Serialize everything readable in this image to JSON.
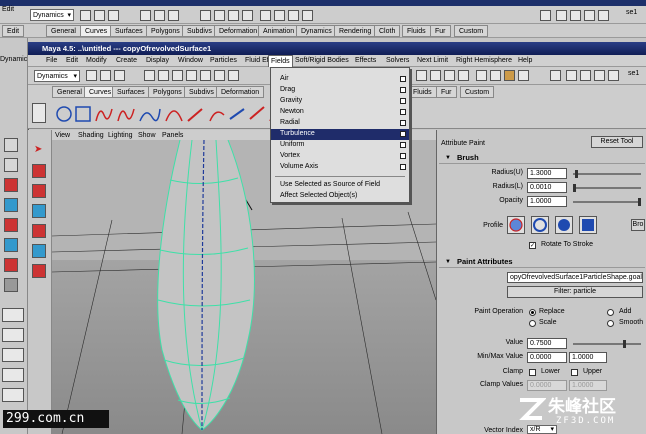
{
  "back_window": {
    "title_fragment": "Maya",
    "menu_items": [
      "Edit",
      "Dynamics",
      "Edit"
    ],
    "mode_dropdown": "Dynamics",
    "shelf_tabs": [
      "General",
      "Curves",
      "Surfaces",
      "Polygons",
      "Subdivs",
      "Deformation",
      "Animation",
      "Dynamics",
      "Rendering",
      "Cloth",
      "Fluids",
      "Fur",
      "Custom"
    ],
    "right_label": "se1"
  },
  "main_window": {
    "title": "Maya 4.5: ..\\untitled  ---  copyOfrevolvedSurface1",
    "menu": [
      "File",
      "Edit",
      "Modify",
      "Create",
      "Display",
      "Window",
      "Particles",
      "Fluid Effects",
      "Fields",
      "Soft/Rigid Bodies",
      "Effects",
      "Solvers",
      "Next Limit",
      "Right Hemisphere",
      "Help"
    ],
    "mode_dropdown": "Dynamics",
    "right_label": "se1",
    "shelf_tabs": [
      "General",
      "Curves",
      "Surfaces",
      "Polygons",
      "Subdivs",
      "Deformation",
      "Fluids",
      "Fur",
      "Custom"
    ],
    "left_label": "Dynamic"
  },
  "fields_menu": {
    "items": [
      {
        "label": "Air",
        "option": true
      },
      {
        "label": "Drag",
        "option": true
      },
      {
        "label": "Gravity",
        "option": true
      },
      {
        "label": "Newton",
        "option": true
      },
      {
        "label": "Radial",
        "option": true
      },
      {
        "label": "Turbulence",
        "option": true,
        "selected": true
      },
      {
        "label": "Uniform",
        "option": true
      },
      {
        "label": "Vortex",
        "option": true
      },
      {
        "label": "Volume Axis",
        "option": true
      }
    ],
    "extra_items": [
      "Use Selected as Source of Field",
      "Affect Selected Object(s)"
    ]
  },
  "viewport": {
    "menu": [
      "View",
      "Shading",
      "Lighting",
      "Show",
      "Panels"
    ]
  },
  "attr_panel": {
    "title": "Attribute Paint",
    "reset_button": "Reset Tool",
    "brush": {
      "header": "Brush",
      "radius_u_label": "Radius(U)",
      "radius_u": "1.3000",
      "radius_l_label": "Radius(L)",
      "radius_l": "0.0010",
      "opacity_label": "Opacity",
      "opacity": "1.0000",
      "profile_label": "Profile",
      "browse_button": "Bro",
      "rotate_label": "Rotate To Stroke",
      "rotate_checked": true
    },
    "paint_attributes": {
      "header": "Paint Attributes",
      "attr_field": "opyOfrevolvedSurface1ParticleShape.goalP",
      "filter_button": "Filter: particle",
      "operation_label": "Paint Operation",
      "operations": [
        "Replace",
        "Add",
        "Scale",
        "Smooth"
      ],
      "operation_selected": "Replace",
      "value_label": "Value",
      "value": "0.7500",
      "minmax_label": "Min/Max Value",
      "min_value": "0.0000",
      "max_value": "1.0000",
      "clamp_label": "Clamp",
      "clamp_lower": "Lower",
      "clamp_upper": "Upper",
      "clamp_values_label": "Clamp Values",
      "clamp_min": "0.0000",
      "clamp_max": "1.0000",
      "vector_index_label": "Vector Index",
      "vector_index": "x/R"
    }
  },
  "watermarks": {
    "left": "299.com.cn",
    "right_cn": "朱峰社区",
    "right_en": "ZF3D.COM"
  },
  "colors": {
    "title_bar": "#1f2c6a",
    "wire": "#3fe0a8",
    "selection": "#1f2c6a"
  }
}
